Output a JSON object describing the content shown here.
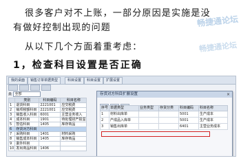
{
  "document": {
    "paragraph1": "很多客户对不上账，一部分原因是实施是没",
    "paragraph2": "有做好控制出现的问题",
    "paragraph3": "从以下几个方面着重考虑：",
    "heading": "1，检查科目设置是否正确",
    "watermark1": "畅捷通论坛",
    "watermark2": "畅捷通论坛"
  },
  "screenshot": {
    "tabs": [
      "我的桌面",
      "销售订单单据类型",
      "科目设置",
      "科目设置",
      "扩展设置"
    ],
    "filter_label": "类",
    "filter_value": "全部",
    "grid": {
      "columns": [
        "",
        "类别",
        "科目编码",
        "科目名称"
      ],
      "rows": [
        [
          "1",
          "退货科目",
          "2221001",
          "应交税费"
        ],
        [
          "2",
          "销项税额科目",
          "2221001",
          "应交税费"
        ],
        [
          "3",
          "销售收入科目",
          "6001",
          "主营业务收入"
        ],
        [
          "4",
          "成本科目",
          "1901",
          "待处理财产损溢"
        ],
        [
          "5",
          "暂估科目",
          "1405",
          "库存商品"
        ],
        [
          "6",
          "存货对方科目",
          "",
          ""
        ],
        [
          "7",
          "采购科目",
          "1401",
          "材料采购"
        ],
        [
          "8",
          "销售成本科目",
          "1405",
          "库存商品"
        ],
        [
          "9",
          "委外科目",
          "",
          ""
        ],
        [
          "10",
          "发出商品科目",
          "1406",
          ""
        ]
      ]
    },
    "dialog": {
      "title": "存货对方科目扩展设置",
      "close_icon": "×",
      "columns": [
        "序号",
        "单据类型",
        "业务类型",
        "存货分类",
        "科目编码",
        "科目名称"
      ],
      "rows": [
        [
          "1",
          "材料出库单",
          "",
          "",
          "5001",
          "生产成本"
        ],
        [
          "2",
          "产成品入库单",
          "",
          "",
          "5001",
          "生产成本"
        ],
        [
          "3",
          "销售出库单",
          "",
          "",
          "6401",
          "主营业务成本"
        ]
      ]
    }
  }
}
